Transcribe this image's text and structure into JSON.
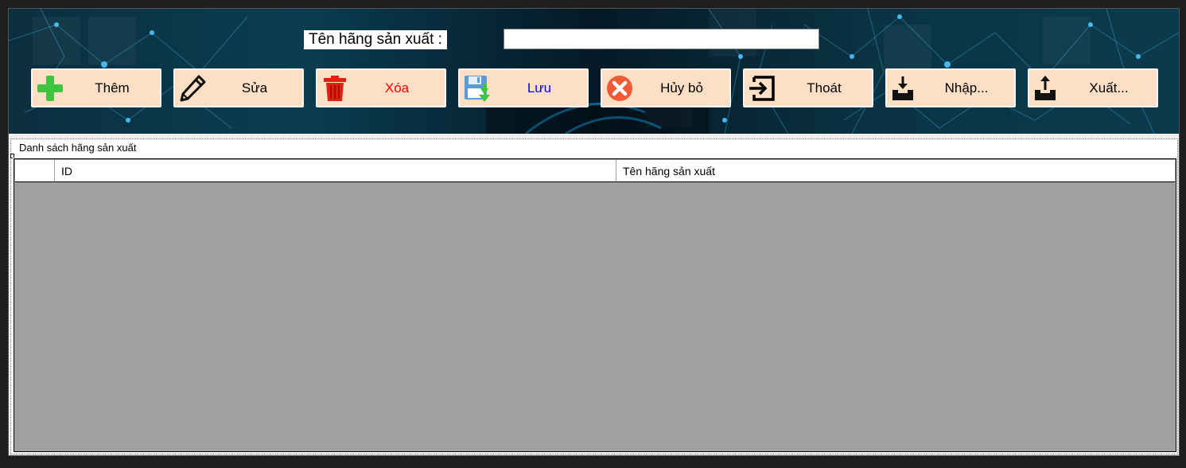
{
  "form": {
    "name_label": "Tên hãng sản xuất :",
    "name_value": ""
  },
  "toolbar": {
    "buttons": [
      {
        "key": "add",
        "label": "Thêm",
        "color": "#000000",
        "icon": "plus-icon"
      },
      {
        "key": "edit",
        "label": "Sửa",
        "color": "#000000",
        "icon": "pencil-icon"
      },
      {
        "key": "delete",
        "label": "Xóa",
        "color": "#ff0000",
        "icon": "trash-icon"
      },
      {
        "key": "save",
        "label": "Lưu",
        "color": "#0000ff",
        "icon": "floppy-save-icon"
      },
      {
        "key": "cancel",
        "label": "Hủy bỏ",
        "color": "#000000",
        "icon": "cancel-x-icon"
      },
      {
        "key": "exit",
        "label": "Thoát",
        "color": "#000000",
        "icon": "exit-icon"
      },
      {
        "key": "import",
        "label": "Nhập...",
        "color": "#000000",
        "icon": "import-icon"
      },
      {
        "key": "export",
        "label": "Xuất...",
        "color": "#000000",
        "icon": "export-icon"
      }
    ]
  },
  "list": {
    "title": "Danh sách hãng sản xuất",
    "columns": [
      "ID",
      "Tên hãng sản xuất"
    ],
    "rows": []
  },
  "colors": {
    "button_bg": "#fddfc5",
    "grid_bg": "#a0a0a0"
  }
}
